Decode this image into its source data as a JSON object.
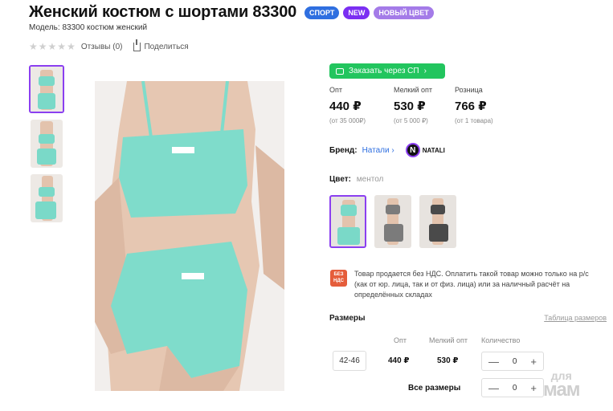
{
  "product": {
    "title": "Женский костюм с шортами 83300",
    "badges": {
      "sport": "СПОРТ",
      "new": "NEW",
      "new_color": "НОВЫЙ ЦВЕТ"
    },
    "model": "Модель: 83300 костюм женский",
    "reviews": "Отзывы (0)",
    "share": "Поделиться"
  },
  "order_button": {
    "label": "Заказать через СП",
    "icon": "cart-icon",
    "color": "#22c55e"
  },
  "prices": [
    {
      "label": "Опт",
      "value": "440 ₽",
      "note": "(от 35 000₽)"
    },
    {
      "label": "Мелкий опт",
      "value": "530 ₽",
      "note": "(от 5 000 ₽)"
    },
    {
      "label": "Розница",
      "value": "766 ₽",
      "note": "(от 1 товара)"
    }
  ],
  "brand": {
    "label": "Бренд:",
    "value": "Натали",
    "logo_letter": "N",
    "logo_text": "NATALI"
  },
  "color": {
    "label": "Цвет:",
    "value": "ментол"
  },
  "nds": {
    "icon_text": "БЕЗ НДС",
    "text": "Товар продается без НДС. Оплатить такой товар можно только на р/с (как от юр. лица, так и от физ. лица) или за наличный расчёт на определённых складах"
  },
  "sizes": {
    "title": "Размеры",
    "table_link": "Таблица размеров",
    "headers": {
      "opt": "Опт",
      "small_opt": "Мелкий опт",
      "quantity": "Количество"
    },
    "rows": [
      {
        "size": "42-46",
        "opt": "440 ₽",
        "small_opt": "530 ₽",
        "qty": "0"
      }
    ],
    "all_sizes": {
      "label": "Все размеры",
      "qty": "0"
    },
    "minus": "—",
    "plus": "+"
  },
  "watermark": {
    "top": "для",
    "bottom": "мам"
  },
  "accent_colors": {
    "purple": "#8b3ff0",
    "blue": "#2f6fe0",
    "green": "#22c55e",
    "mint": "#7ad9c8"
  }
}
